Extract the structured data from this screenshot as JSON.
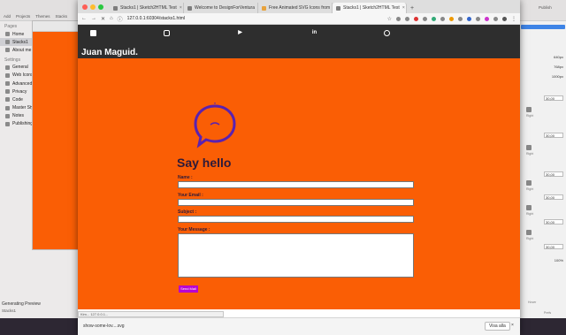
{
  "left_app": {
    "toolbar": [
      "Add",
      "Projects",
      "Themes",
      "Stacks",
      "Resources"
    ],
    "sections": [
      {
        "label": "Pages",
        "items": [
          "Home",
          "Stacks1",
          "About me"
        ]
      },
      {
        "label": "Settings",
        "items": [
          "General",
          "Web Icons",
          "Advanced",
          "Privacy",
          "Code",
          "Master Style",
          "Notes",
          "Publishing"
        ]
      }
    ],
    "selected_item": "Stacks1",
    "status": "Generating Preview",
    "footer": "Stacks1"
  },
  "right_panel": {
    "top_label": "Publish",
    "values": [
      "640px",
      "768px",
      "1000px"
    ],
    "fields": [
      "30,00",
      "30,00",
      "30,00",
      "30,00",
      "30,00",
      "30,00"
    ],
    "captions": [
      "Right",
      "Right",
      "Right",
      "Right",
      "Right",
      "Right"
    ],
    "percent": "100%",
    "bottom_labels": [
      "Hover",
      "Prefs"
    ]
  },
  "browser": {
    "tabs": [
      {
        "title": "Stacks1 | Sketch2HTML Test",
        "active": false
      },
      {
        "title": "Welcome to DesignForVentura",
        "active": false
      },
      {
        "title": "Free Animated SVG Icons from",
        "active": false
      },
      {
        "title": "Stacks1 | Sketch2HTML Test",
        "active": true
      }
    ],
    "url": "127.0.0.1:60304/stacks1.html",
    "new_tab": "+"
  },
  "page": {
    "brand": "Juan Maguid.",
    "heading": "Say hello",
    "form": {
      "name_label": "Name :",
      "email_label": "Your Email :",
      "subject_label": "Subject :",
      "message_label": "Your Message :",
      "send_label": "Send Mail"
    },
    "social_icons": [
      "twitter-icon",
      "instagram-icon",
      "youtube-icon",
      "linkedin-icon",
      "dribbble-icon"
    ],
    "colors": {
      "background": "#fa5e05",
      "nav": "#2e2e2e",
      "button": "#b800d0",
      "bubble": "#5a22b0"
    }
  },
  "status_tip": "Kim... 127.0.0.1...",
  "downloads": {
    "item": "show-some-lov....svg",
    "show_all": "Visa alla",
    "close": "×"
  }
}
